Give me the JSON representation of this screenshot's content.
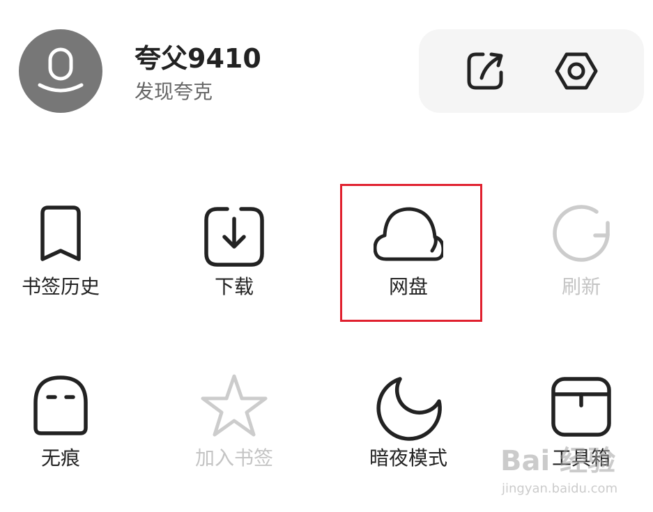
{
  "profile": {
    "username": "夸父9410",
    "subtitle": "发现夸克"
  },
  "header_actions": [
    {
      "id": "share",
      "icon": "share-arrow-icon"
    },
    {
      "id": "settings",
      "icon": "settings-hexagon-icon"
    }
  ],
  "menu": [
    {
      "label": "书签历史",
      "icon": "bookmark-icon",
      "enabled": true
    },
    {
      "label": "下载",
      "icon": "download-icon",
      "enabled": true
    },
    {
      "label": "网盘",
      "icon": "cloud-icon",
      "enabled": true,
      "highlighted": true
    },
    {
      "label": "刷新",
      "icon": "refresh-icon",
      "enabled": false
    },
    {
      "label": "无痕",
      "icon": "incognito-ghost-icon",
      "enabled": true
    },
    {
      "label": "加入书签",
      "icon": "star-icon",
      "enabled": false
    },
    {
      "label": "暗夜模式",
      "icon": "moon-icon",
      "enabled": true
    },
    {
      "label": "工具箱",
      "icon": "toolbox-icon",
      "enabled": true
    }
  ],
  "watermark": {
    "logo": "Bai 经验",
    "url": "jingyan.baidu.com"
  },
  "colors": {
    "highlight": "#e0202e",
    "avatar_bg": "#777777",
    "panel_bg": "#f5f5f5",
    "text": "#222222",
    "disabled": "#c4c4c4"
  }
}
